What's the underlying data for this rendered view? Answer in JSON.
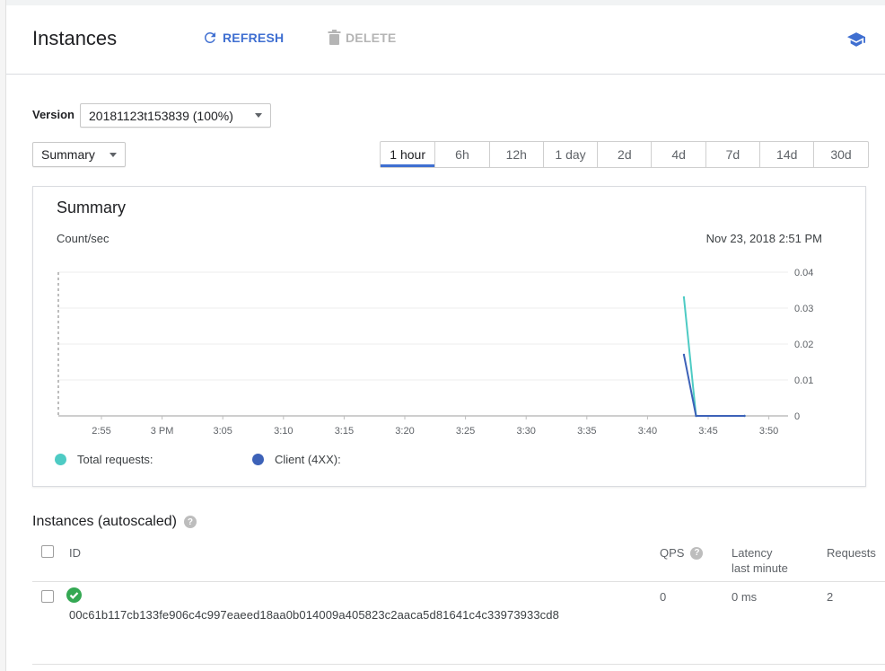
{
  "header": {
    "title": "Instances",
    "refresh_label": "REFRESH",
    "delete_label": "DELETE",
    "refresh_icon": "refresh-icon",
    "delete_icon": "trash-icon",
    "help_icon": "graduation-cap-icon"
  },
  "version": {
    "label": "Version",
    "selected": "20181123t153839 (100%)"
  },
  "view_select": {
    "selected": "Summary"
  },
  "time_ranges": {
    "options": [
      "1 hour",
      "6h",
      "12h",
      "1 day",
      "2d",
      "4d",
      "7d",
      "14d",
      "30d"
    ],
    "active": "1 hour"
  },
  "summary_card": {
    "title": "Summary",
    "unit_label": "Count/sec",
    "timestamp": "Nov 23, 2018 2:51 PM"
  },
  "chart_data": {
    "type": "line",
    "ylabel": "Count/sec",
    "ylim": [
      0,
      0.04
    ],
    "yticks": [
      "0",
      "0.01",
      "0.02",
      "0.03",
      "0.04"
    ],
    "xticks": [
      "2:55",
      "3 PM",
      "3:05",
      "3:10",
      "3:15",
      "3:20",
      "3:25",
      "3:30",
      "3:35",
      "3:40",
      "3:45",
      "3:50"
    ],
    "grid": true,
    "legend_position": "bottom",
    "series": [
      {
        "name": "Total requests:",
        "color": "#4ecbc4",
        "x": [
          "3:43",
          "3:44",
          "3:48"
        ],
        "values": [
          0.033,
          0,
          0
        ]
      },
      {
        "name": "Client (4XX):",
        "color": "#3d62b8",
        "x": [
          "3:43",
          "3:44",
          "3:48"
        ],
        "values": [
          0.017,
          0,
          0
        ]
      }
    ]
  },
  "instances": {
    "title": "Instances (autoscaled)",
    "columns": {
      "id": "ID",
      "qps": "QPS",
      "latency_line1": "Latency",
      "latency_line2": "last minute",
      "requests": "Requests"
    },
    "rows": [
      {
        "status": "check-circle-icon",
        "id": "00c61b117cb133fe906c4c997eaeed18aa0b014009a405823c2aaca5d81641c4c33973933cd8",
        "qps": "0",
        "latency": "0 ms",
        "requests": "2"
      }
    ]
  }
}
